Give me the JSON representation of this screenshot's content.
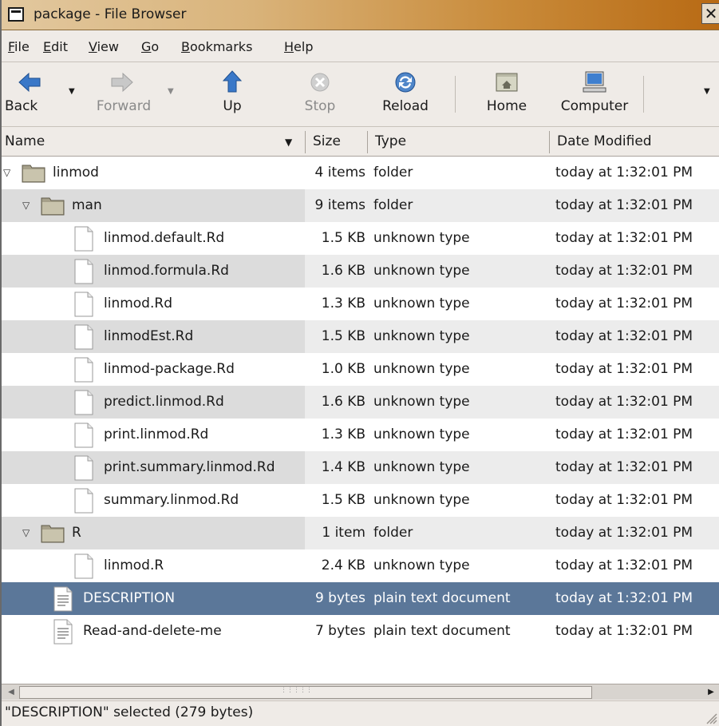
{
  "window": {
    "title": "package - File Browser"
  },
  "menu": [
    {
      "label": "File",
      "mnemonic": "F",
      "rest": "ile"
    },
    {
      "label": "Edit",
      "mnemonic": "E",
      "rest": "dit"
    },
    {
      "label": "View",
      "mnemonic": "V",
      "rest": "iew"
    },
    {
      "label": "Go",
      "mnemonic": "G",
      "rest": "o"
    },
    {
      "label": "Bookmarks",
      "mnemonic": "B",
      "rest": "ookmarks"
    },
    {
      "label": "Help",
      "mnemonic": "H",
      "rest": "elp"
    }
  ],
  "toolbar": {
    "back": "Back",
    "forward": "Forward",
    "up": "Up",
    "stop": "Stop",
    "reload": "Reload",
    "home": "Home",
    "computer": "Computer"
  },
  "columns": {
    "name": "Name",
    "size": "Size",
    "type": "Type",
    "date": "Date Modified"
  },
  "rows": [
    {
      "name": "linmod",
      "size": "4 items",
      "type": "folder",
      "date": "today at 1:32:01 PM",
      "kind": "folder",
      "depth": 0,
      "expanded": true
    },
    {
      "name": "man",
      "size": "9 items",
      "type": "folder",
      "date": "today at 1:32:01 PM",
      "kind": "folder",
      "depth": 1,
      "expanded": true
    },
    {
      "name": "linmod.default.Rd",
      "size": "1.5 KB",
      "type": "unknown type",
      "date": "today at 1:32:01 PM",
      "kind": "file",
      "depth": 2
    },
    {
      "name": "linmod.formula.Rd",
      "size": "1.6 KB",
      "type": "unknown type",
      "date": "today at 1:32:01 PM",
      "kind": "file",
      "depth": 2
    },
    {
      "name": "linmod.Rd",
      "size": "1.3 KB",
      "type": "unknown type",
      "date": "today at 1:32:01 PM",
      "kind": "file",
      "depth": 2
    },
    {
      "name": "linmodEst.Rd",
      "size": "1.5 KB",
      "type": "unknown type",
      "date": "today at 1:32:01 PM",
      "kind": "file",
      "depth": 2
    },
    {
      "name": "linmod-package.Rd",
      "size": "1.0 KB",
      "type": "unknown type",
      "date": "today at 1:32:01 PM",
      "kind": "file",
      "depth": 2
    },
    {
      "name": "predict.linmod.Rd",
      "size": "1.6 KB",
      "type": "unknown type",
      "date": "today at 1:32:01 PM",
      "kind": "file",
      "depth": 2
    },
    {
      "name": "print.linmod.Rd",
      "size": "1.3 KB",
      "type": "unknown type",
      "date": "today at 1:32:01 PM",
      "kind": "file",
      "depth": 2
    },
    {
      "name": "print.summary.linmod.Rd",
      "size": "1.4 KB",
      "type": "unknown type",
      "date": "today at 1:32:01 PM",
      "kind": "file",
      "depth": 2
    },
    {
      "name": "summary.linmod.Rd",
      "size": "1.5 KB",
      "type": "unknown type",
      "date": "today at 1:32:01 PM",
      "kind": "file",
      "depth": 2
    },
    {
      "name": "R",
      "size": "1 item",
      "type": "folder",
      "date": "today at 1:32:01 PM",
      "kind": "folder",
      "depth": 1,
      "expanded": true
    },
    {
      "name": "linmod.R",
      "size": "2.4 KB",
      "type": "unknown type",
      "date": "today at 1:32:01 PM",
      "kind": "file",
      "depth": 2
    },
    {
      "name": "DESCRIPTION",
      "size": "9 bytes",
      "type": "plain text document",
      "date": "today at 1:32:01 PM",
      "kind": "text",
      "depth": 1,
      "selected": true
    },
    {
      "name": "Read-and-delete-me",
      "size": "7 bytes",
      "type": "plain text document",
      "date": "today at 1:32:01 PM",
      "kind": "text",
      "depth": 1
    }
  ],
  "status": {
    "text": "\"DESCRIPTION\" selected (279 bytes)"
  },
  "colors": {
    "selection": "#5b7799",
    "titlebar_end": "#b86a14",
    "back_icon": "#3a78c8"
  }
}
